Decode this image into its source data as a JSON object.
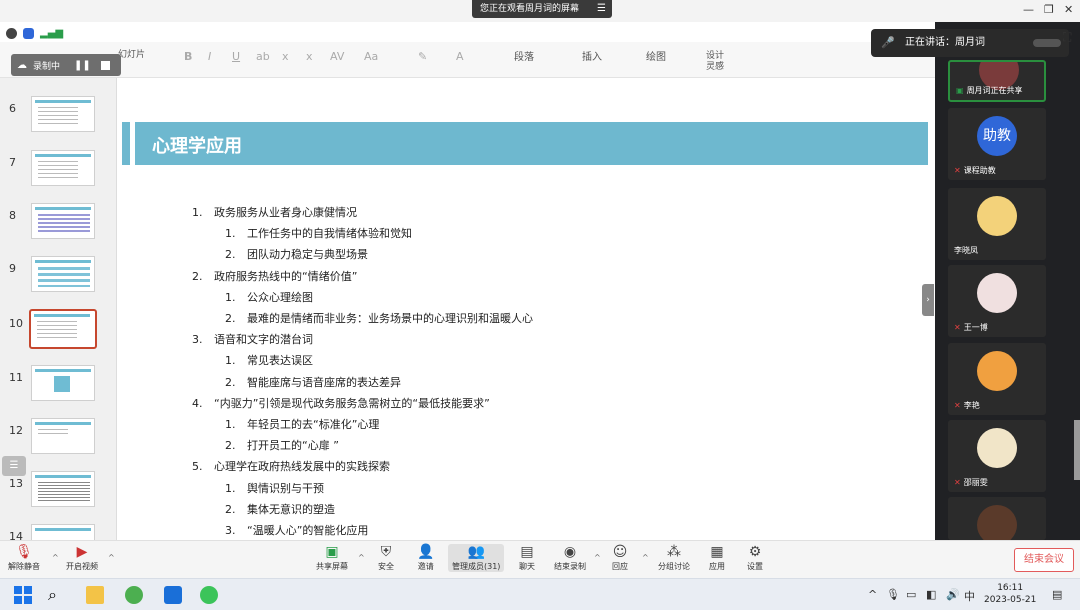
{
  "app": {
    "share_banner": "您正在观看周月词的屏幕",
    "speaking": "正在讲话：周月词",
    "recording_label": "录制中"
  },
  "ribbon": {
    "left_cut": "幻灯片",
    "items": [
      "段落",
      "插入",
      "绘图"
    ],
    "design_line1": "设计",
    "design_line2": "灵感"
  },
  "thumbnails": [
    "6",
    "7",
    "8",
    "9",
    "10",
    "11",
    "12",
    "13",
    "14"
  ],
  "selected_slide": "10",
  "slide": {
    "title": "心理学应用",
    "outline": [
      {
        "level": 1,
        "num": "1.",
        "text": "政务服务从业者身心康健情况"
      },
      {
        "level": 2,
        "num": "1.",
        "text": "工作任务中的自我情绪体验和觉知"
      },
      {
        "level": 2,
        "num": "2.",
        "text": "团队动力稳定与典型场景"
      },
      {
        "level": 1,
        "num": "2.",
        "text": "政府服务热线中的“情绪价值”"
      },
      {
        "level": 2,
        "num": "1.",
        "text": "公众心理绘图"
      },
      {
        "level": 2,
        "num": "2.",
        "text": "最难的是情绪而非业务：业务场景中的心理识别和温暖人心"
      },
      {
        "level": 1,
        "num": "3.",
        "text": "语音和文字的潜台词"
      },
      {
        "level": 2,
        "num": "1.",
        "text": "常见表达误区"
      },
      {
        "level": 2,
        "num": "2.",
        "text": "智能座席与语音座席的表达差异"
      },
      {
        "level": 1,
        "num": "4.",
        "text": "“内驱力”引领是现代政务服务急需树立的“最低技能要求”"
      },
      {
        "level": 2,
        "num": "1.",
        "text": "年轻员工的去“标准化”心理"
      },
      {
        "level": 2,
        "num": "2.",
        "text": "打开员工的“心扉 ”"
      },
      {
        "level": 1,
        "num": "5.",
        "text": "心理学在政府热线发展中的实践探索"
      },
      {
        "level": 2,
        "num": "1.",
        "text": "舆情识别与干预"
      },
      {
        "level": 2,
        "num": "2.",
        "text": "集体无意识的塑造"
      },
      {
        "level": 2,
        "num": "3.",
        "text": "“温暖人心”的智能化应用"
      }
    ]
  },
  "participants": [
    {
      "name": "周月词正在共享",
      "color": "#7a3b3b"
    },
    {
      "name": "课程助教",
      "avatar_text": "助教",
      "color": "#2f67d8"
    },
    {
      "name": "李晓凤",
      "color": "#f3d27a"
    },
    {
      "name": "王一博",
      "color": "#f0e0e0"
    },
    {
      "name": "李艳",
      "color": "#f0a040"
    },
    {
      "name": "邵丽雯",
      "color": "#f1e5c8"
    },
    {
      "name": "",
      "color": "#5a3a2a"
    }
  ],
  "toolbar": {
    "mute": "解除静音",
    "video": "开启视频",
    "share": "共享屏幕",
    "security": "安全",
    "invite": "邀请",
    "members": "管理成员(31)",
    "chat": "聊天",
    "end_rec": "结束录制",
    "react": "回应",
    "breakout": "分组讨论",
    "apps": "应用",
    "settings": "设置",
    "end_meeting": "结束会议"
  },
  "taskbar": {
    "ime": "中",
    "time": "16:11",
    "date": "2023-05-21"
  }
}
